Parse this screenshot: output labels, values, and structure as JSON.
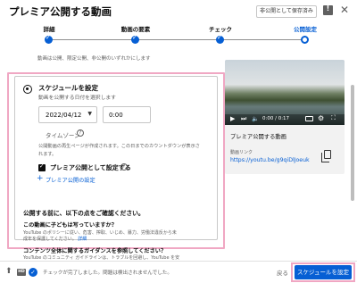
{
  "header": {
    "title": "プレミア公開する動画",
    "save_draft": "非公開として保存済み"
  },
  "stepper": {
    "steps": [
      {
        "label": "詳細"
      },
      {
        "label": "動画の要素"
      },
      {
        "label": "チェック"
      },
      {
        "label": "公開設定"
      }
    ]
  },
  "visibility": {
    "save_or_publish_desc": "動画は公開、限定公開、非公開のいずれかにします"
  },
  "schedule": {
    "title": "スケジュールを設定",
    "description": "動画を公開する日付を選択します",
    "date": "2022/04/12",
    "time": "0:00",
    "timezone_label": "タイムゾーン",
    "timezone_desc_line1": "公開動画の再生ページが作成されます。この日までのカウントダウンが表示さ",
    "timezone_desc_line2": "れます。",
    "premiere_checkbox_label": "プレミア公開として設定する",
    "premiere_settings_link": "プレミア公開の設定"
  },
  "notice": {
    "before_publish": "公開する前に、以下の点をご確認ください。",
    "kids_question": "この動画に子どもは写っていますか？",
    "kids_desc_line1": "YouTube のポリシーに従い、危害、搾取、いじめ、暴力、労働法違反から未",
    "kids_desc_line2": "成年を保護してください。",
    "kids_desc_link": "詳細",
    "guidelines_question": "コンテンツ全体に関するガイダンスを参照してください？",
    "guidelines_desc": "YouTube のコミュニティ ガイドラインは、トラブルを回避し、YouTube を安"
  },
  "preview": {
    "time": "0:00 / 0:17",
    "title": "プレミア公開する動画",
    "link_label": "動画リンク",
    "link": "https://youtu.be/g9qiDlJoeuk"
  },
  "footer": {
    "hd_badge": "HD",
    "check_message": "チェックが完了しました。問題は検出されませんでした。",
    "back_label": "戻る",
    "schedule_button": "スケジュールを設定"
  },
  "colors": {
    "accent": "#065fd4",
    "highlight": "#f0a7c3"
  }
}
